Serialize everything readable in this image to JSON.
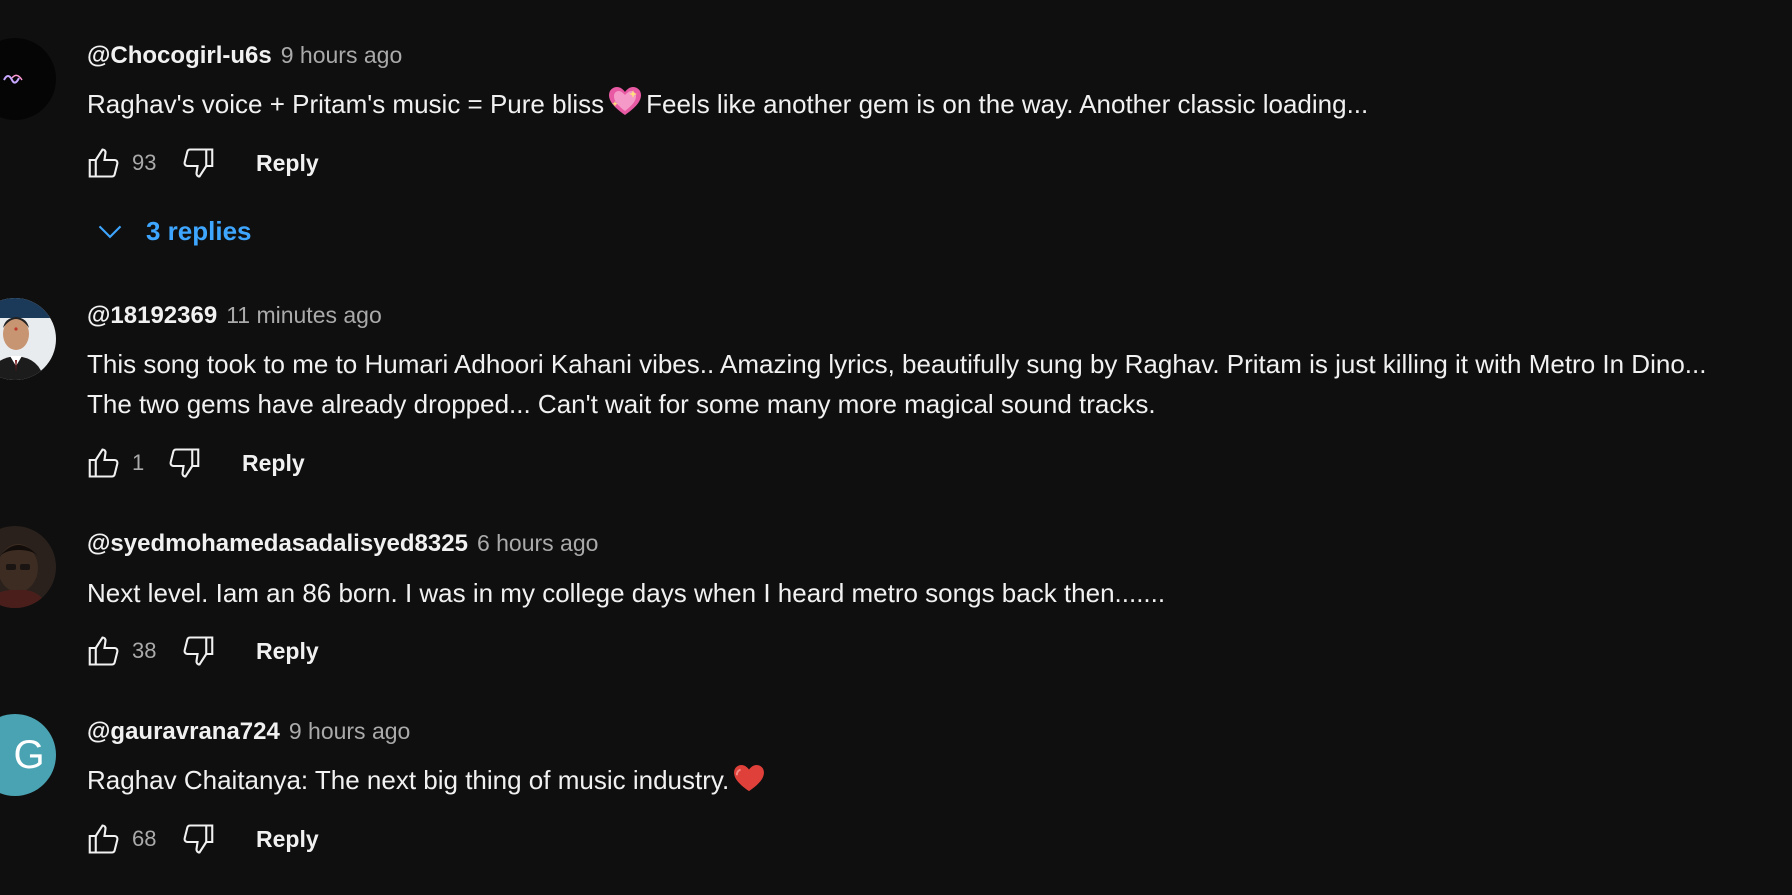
{
  "comments": [
    {
      "author": "@Chocogirl-u6s",
      "time": "9 hours ago",
      "text_before_emoji": "Raghav's voice + Pritam's music = Pure bliss",
      "emoji": "sparkling-heart",
      "text_after_emoji": "Feels like another gem is on the way. Another classic loading...",
      "likes": "93",
      "reply_label": "Reply",
      "replies_label": "3 replies"
    },
    {
      "author": "@18192369",
      "time": "11 minutes ago",
      "text": "This song took to me to Humari Adhoori Kahani vibes.. Amazing lyrics, beautifully sung by Raghav. Pritam is just killing it with Metro In Dino... The two gems have already dropped... Can't wait for some many more magical sound tracks.",
      "likes": "1",
      "reply_label": "Reply"
    },
    {
      "author": "@syedmohamedasadalisyed8325",
      "time": "6 hours ago",
      "text": "Next level. Iam an 86 born. I was in my college days when I heard metro songs back then.......",
      "likes": "38",
      "reply_label": "Reply"
    },
    {
      "author": "@gauravrana724",
      "time": "9 hours ago",
      "avatar_letter": "G",
      "text_before_emoji": "Raghav Chaitanya: The next big thing of music industry.",
      "emoji": "red-heart",
      "likes": "68",
      "reply_label": "Reply"
    }
  ],
  "icons": {
    "like": "thumbs-up-outline-icon",
    "dislike": "thumbs-down-outline-icon",
    "expand": "chevron-down-icon"
  },
  "colors": {
    "background": "#0f0f0f",
    "primary_text": "#f1f1f1",
    "secondary_text": "#aaaaaa",
    "link_blue": "#3ea6ff",
    "avatar_g": "#4aa3b2"
  }
}
